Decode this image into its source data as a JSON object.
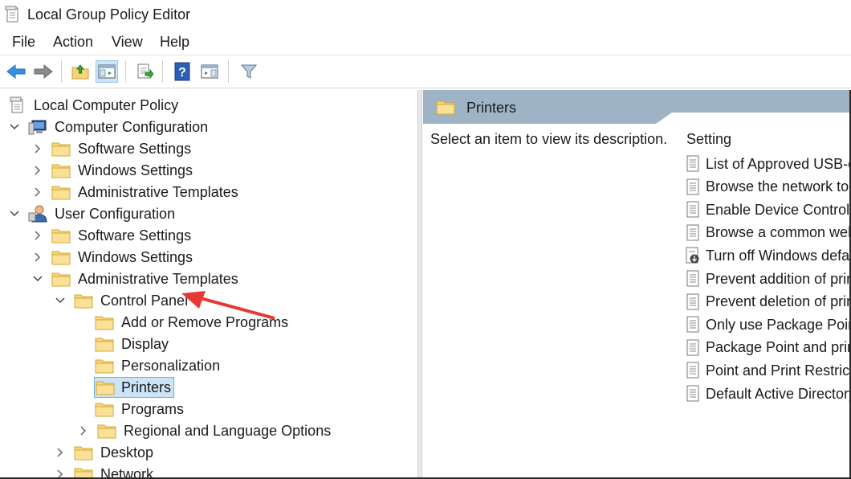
{
  "window": {
    "title": "Local Group Policy Editor"
  },
  "menu": [
    "File",
    "Action",
    "View",
    "Help"
  ],
  "toolbar": {
    "buttons": [
      "back-icon",
      "forward-icon",
      "up-folder-icon",
      "show-hide-tree-icon",
      "export-list-icon",
      "help-icon",
      "show-action-pane-icon",
      "filter-icon"
    ]
  },
  "tree": {
    "root": "Local Computer Policy",
    "computer_config": "Computer Configuration",
    "cc_software": "Software Settings",
    "cc_windows": "Windows Settings",
    "cc_admin": "Administrative Templates",
    "user_config": "User Configuration",
    "uc_software": "Software Settings",
    "uc_windows": "Windows Settings",
    "uc_admin": "Administrative Templates",
    "control_panel": "Control Panel",
    "add_remove": "Add or Remove Programs",
    "display": "Display",
    "personalization": "Personalization",
    "printers": "Printers",
    "programs": "Programs",
    "regional": "Regional and Language Options",
    "desktop": "Desktop",
    "network": "Network"
  },
  "right": {
    "title": "Printers",
    "description": "Select an item to view its description.",
    "setting_header": "Setting",
    "settings": [
      "List of Approved USB-c",
      "Browse the network to",
      "Enable Device Control P",
      "Browse a common web",
      "Turn off Windows defa",
      "Prevent addition of prin",
      "Prevent deletion of prin",
      "Only use Package Point",
      "Package Point and prin",
      "Point and Print Restricti",
      "Default Active Directory"
    ]
  },
  "colors": {
    "selection": "#cce4f7",
    "header_band": "#9fb3c6",
    "arrow": "#e53935"
  }
}
